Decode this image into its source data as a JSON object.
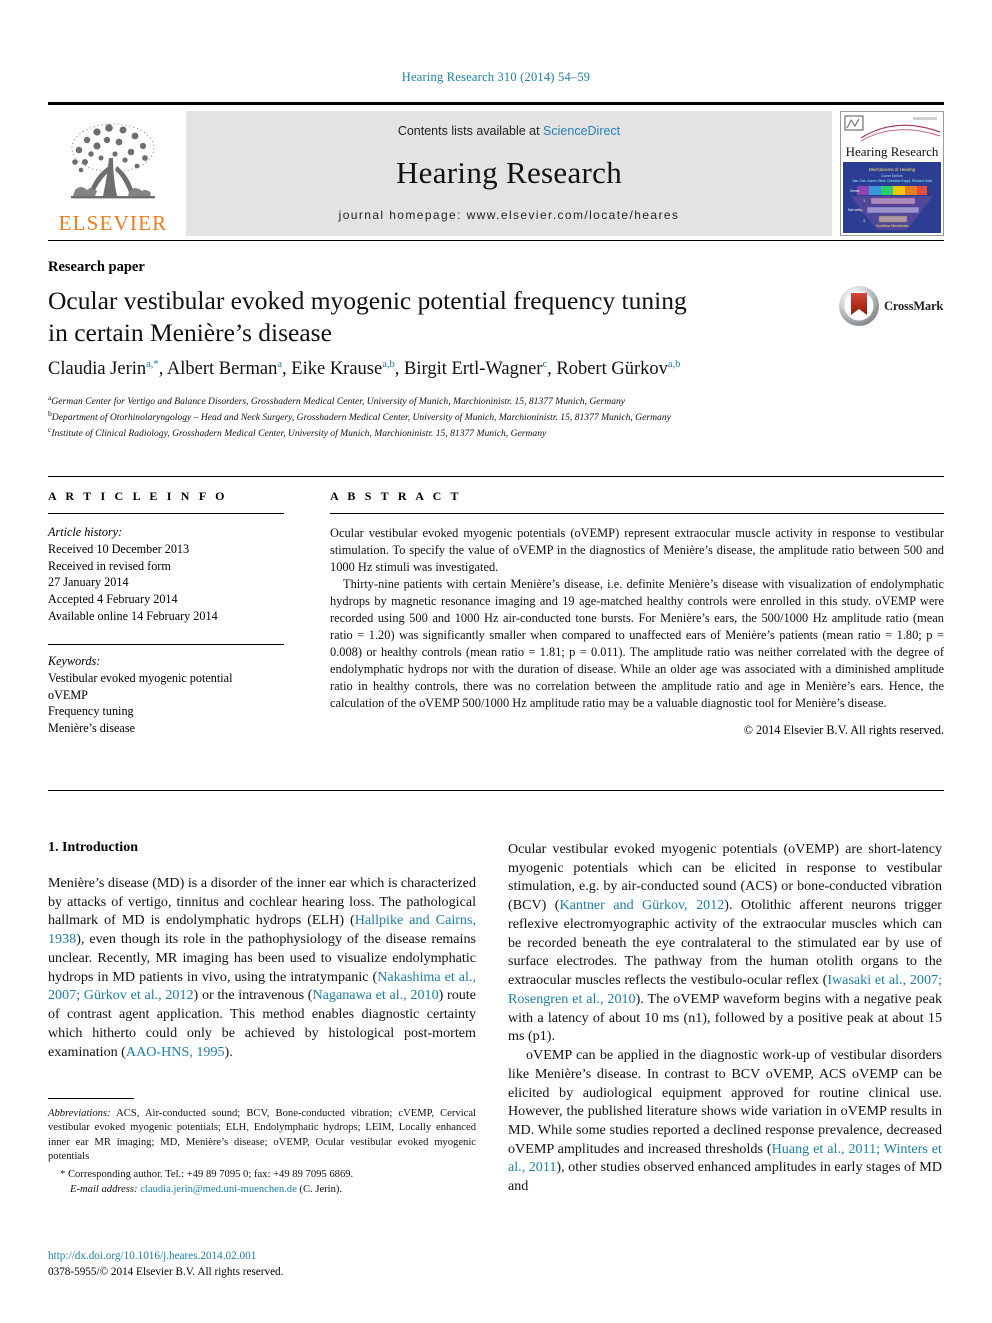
{
  "running_head": "Hearing Research 310 (2014) 54–59",
  "masthead": {
    "publisher_name": "ELSEVIER",
    "contents_prefix": "Contents lists available at ",
    "contents_link": "ScienceDirect",
    "journal_name": "Hearing Research",
    "homepage": "journal homepage: www.elsevier.com/locate/heares",
    "cover_title": "Hearing Research"
  },
  "article": {
    "type": "Research paper",
    "title_line_1": "Ocular vestibular evoked myogenic potential frequency tuning",
    "title_line_2": "in certain Menière’s disease",
    "crossmark_label": "CrossMark",
    "authors_html": "Claudia Jerin<sup>a,*</sup>, Albert Berman<sup>a</sup>, Eike Krause<sup>a,b</sup>, Birgit Ertl-Wagner<sup>c</sup>, Robert Gürkov<sup>a,b</sup>",
    "affiliations": [
      "German Center for Vertigo and Balance Disorders, Grosshadern Medical Center, University of Munich, Marchioninistr. 15, 81377 Munich, Germany",
      "Department of Otorhinolaryngology – Head and Neck Surgery, Grosshadern Medical Center, University of Munich, Marchioninistr. 15, 81377 Munich, Germany",
      "Institute of Clinical Radiology, Grosshadern Medical Center, University of Munich, Marchioninistr. 15, 81377 Munich, Germany"
    ],
    "affiliation_marks": [
      "a",
      "b",
      "c"
    ]
  },
  "info": {
    "heading": "A R T I C L E    I N F O",
    "history_label": "Article history:",
    "history_lines": [
      "Received 10 December 2013",
      "Received in revised form",
      "27 January 2014",
      "Accepted 4 February 2014",
      "Available online 14 February 2014"
    ],
    "keywords_label": "Keywords:",
    "keywords": [
      "Vestibular evoked myogenic potential",
      "oVEMP",
      "Frequency tuning",
      "Menière’s disease"
    ]
  },
  "abstract": {
    "heading": "A B S T R A C T",
    "paragraphs": [
      "Ocular vestibular evoked myogenic potentials (oVEMP) represent extraocular muscle activity in response to vestibular stimulation. To specify the value of oVEMP in the diagnostics of Menière’s disease, the amplitude ratio between 500 and 1000 Hz stimuli was investigated.",
      "Thirty-nine patients with certain Menière’s disease, i.e. definite Menière’s disease with visualization of endolymphatic hydrops by magnetic resonance imaging and 19 age-matched healthy controls were enrolled in this study. oVEMP were recorded using 500 and 1000 Hz air-conducted tone bursts. For Menière’s ears, the 500/1000 Hz amplitude ratio (mean ratio = 1.20) was significantly smaller when compared to unaffected ears of Menière’s patients (mean ratio = 1.80; p = 0.008) or healthy controls (mean ratio = 1.81; p = 0.011). The amplitude ratio was neither correlated with the degree of endolymphatic hydrops nor with the duration of disease. While an older age was associated with a diminished amplitude ratio in healthy controls, there was no correlation between the amplitude ratio and age in Menière’s ears. Hence, the calculation of the oVEMP 500/1000 Hz amplitude ratio may be a valuable diagnostic tool for Menière’s disease."
    ],
    "copyright": "© 2014 Elsevier B.V. All rights reserved."
  },
  "body": {
    "section_number_title": "1. Introduction",
    "left_paragraphs": [
      "Menière’s disease (MD) is a disorder of the inner ear which is characterized by attacks of vertigo, tinnitus and cochlear hearing loss. The pathological hallmark of MD is endolymphatic hydrops (ELH) (Hallpike and Cairns, 1938), even though its role in the pathophysiology of the disease remains unclear. Recently, MR imaging has been used to visualize endolymphatic hydrops in MD patients in vivo, using the intratympanic (Nakashima et al., 2007; Gürkov et al., 2012) or the intravenous (Naganawa et al., 2010) route of contrast agent application. This method enables diagnostic certainty which hitherto could only be achieved by histological post-mortem examination (AAO-HNS, 1995)."
    ],
    "right_paragraphs": [
      "Ocular vestibular evoked myogenic potentials (oVEMP) are short-latency myogenic potentials which can be elicited in response to vestibular stimulation, e.g. by air-conducted sound (ACS) or bone-conducted vibration (BCV) (Kantner and Gürkov, 2012). Otolithic afferent neurons trigger reflexive electromyographic activity of the extraocular muscles which can be recorded beneath the eye contralateral to the stimulated ear by use of surface electrodes. The pathway from the human otolith organs to the extraocular muscles reflects the vestibulo-ocular reflex (Iwasaki et al., 2007; Rosengren et al., 2010). The oVEMP waveform begins with a negative peak with a latency of about 10 ms (n1), followed by a positive peak at about 15 ms (p1).",
      "oVEMP can be applied in the diagnostic work-up of vestibular disorders like Menière’s disease. In contrast to BCV oVEMP, ACS oVEMP can be elicited by audiological equipment approved for routine clinical use. However, the published literature shows wide variation in oVEMP results in MD. While some studies reported a declined response prevalence, decreased oVEMP amplitudes and increased thresholds (Huang et al., 2011; Winters et al., 2011), other studies observed enhanced amplitudes in early stages of MD and"
    ]
  },
  "footnotes": {
    "abbreviations_label": "Abbreviations:",
    "abbreviations_text": " ACS, Air-conducted sound; BCV, Bone-conducted vibration; cVEMP, Cervical vestibular evoked myogenic potentials; ELH, Endolymphatic hydrops; LEIM, Locally enhanced inner ear MR imaging; MD, Menière’s disease; oVEMP, Ocular vestibular evoked myogenic potentials",
    "corresponding_author": "* Corresponding author. Tel.: +49 89 7095 0; fax: +49 89 7095 6869.",
    "email_label": "E-mail address:",
    "email": "claudia.jerin@med.uni-muenchen.de",
    "email_suffix": " (C. Jerin)."
  },
  "bottom": {
    "doi": "http://dx.doi.org/10.1016/j.heares.2014.02.001",
    "issn_line": "0378-5955/© 2014 Elsevier B.V. All rights reserved."
  },
  "colors": {
    "link_blue": "#1a7fa8",
    "sciencedirect_blue": "#2a7fbe",
    "elsevier_orange": "#ef7d1a",
    "band_gray": "#e3e3e3"
  }
}
